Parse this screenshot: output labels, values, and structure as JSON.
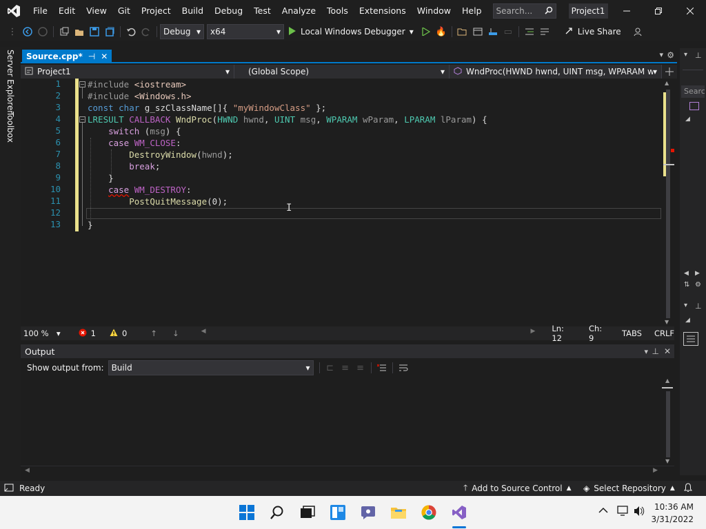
{
  "app": {
    "project_name": "Project1",
    "search_placeholder": "Search...",
    "menu": [
      "File",
      "Edit",
      "View",
      "Git",
      "Project",
      "Build",
      "Debug",
      "Test",
      "Analyze",
      "Tools",
      "Extensions",
      "Window",
      "Help"
    ]
  },
  "toolbar": {
    "config": "Debug",
    "platform": "x64",
    "run_label": "Local Windows Debugger",
    "live_share": "Live Share"
  },
  "left_tabs": [
    "Server Explorer",
    "Toolbox"
  ],
  "document_tab": {
    "name": "Source.cpp*"
  },
  "navbar": {
    "project": "Project1",
    "scope": "(Global Scope)",
    "member": "WndProc(HWND hwnd, UINT msg, WPARAM wPara"
  },
  "editor": {
    "line_numbers": [
      "1",
      "2",
      "3",
      "4",
      "5",
      "6",
      "7",
      "8",
      "9",
      "10",
      "11",
      "12",
      "13"
    ]
  },
  "editor_status": {
    "zoom": "100 %",
    "errors": "1",
    "warnings": "0",
    "position_line": "Ln: 12",
    "position_char": "Ch: 9",
    "indent": "TABS",
    "eol": "CRLF"
  },
  "output": {
    "title": "Output",
    "show_from_label": "Show output from:",
    "source": "Build"
  },
  "right_dock": {
    "search": "Searc"
  },
  "statusbar": {
    "ready": "Ready",
    "source_control": "Add to Source Control",
    "repository": "Select Repository"
  },
  "taskbar": {
    "time": "10:36 AM",
    "date": "3/31/2022"
  },
  "colors": {
    "accent": "#007acc",
    "change_bar": "#eae18c",
    "error": "#e51400",
    "vs_purple": "#865fc5"
  }
}
